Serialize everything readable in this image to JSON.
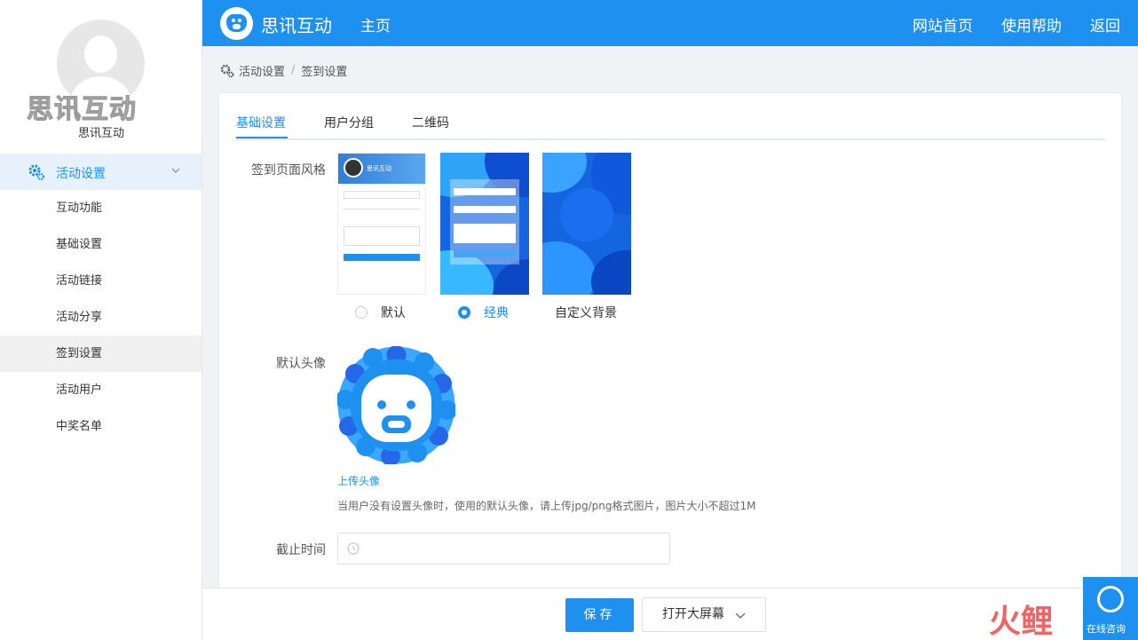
{
  "sidebar": {
    "brand_watermark": "思讯互动",
    "brand_name": "思讯互动",
    "parent_menu": "活动设置",
    "items": [
      {
        "label": "互动功能"
      },
      {
        "label": "基础设置"
      },
      {
        "label": "活动链接"
      },
      {
        "label": "活动分享"
      },
      {
        "label": "签到设置",
        "active": true
      },
      {
        "label": "活动用户"
      },
      {
        "label": "中奖名单"
      }
    ]
  },
  "header": {
    "title": "思讯互动",
    "home": "主页",
    "links": [
      "网站首页",
      "使用帮助",
      "返回"
    ]
  },
  "breadcrumb": {
    "parent": "活动设置",
    "current": "签到设置"
  },
  "tabs": [
    {
      "label": "基础设置",
      "active": true
    },
    {
      "label": "用户分组"
    },
    {
      "label": "二维码"
    }
  ],
  "form": {
    "style_label": "签到页面风格",
    "style_thumb_name": "思讯互动",
    "styles": [
      {
        "label": "默认",
        "selected": false
      },
      {
        "label": "经典",
        "selected": true
      },
      {
        "label": "自定义背景",
        "selected": false
      }
    ],
    "avatar_label": "默认头像",
    "upload_link": "上传头像",
    "avatar_hint": "当用户没有设置头像时，使用的默认头像，请上传jpg/png格式图片，图片大小不超过1M",
    "deadline_label": "截止时间",
    "deadline_value": ""
  },
  "footer": {
    "save": "保存",
    "open_screen": "打开大屏幕"
  },
  "widget": {
    "consult": "在线咨询",
    "watermark": "火鲤"
  },
  "colors": {
    "accent": "#1e90f0",
    "sidebar_active": "#e6f1fc"
  }
}
